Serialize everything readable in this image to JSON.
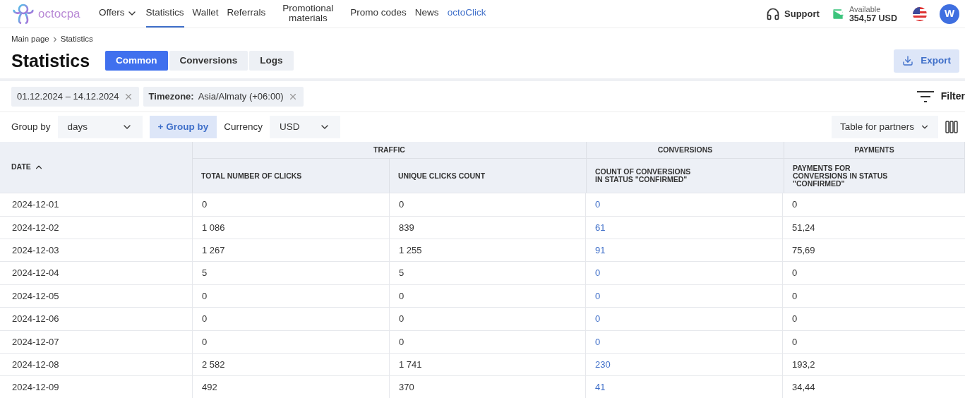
{
  "logo": {
    "text": "octocpa"
  },
  "nav": [
    {
      "label": "Offers",
      "kind": "dropdown",
      "selected": false
    },
    {
      "label": "Statistics",
      "kind": "link",
      "selected": true
    },
    {
      "label": "Wallet",
      "kind": "link",
      "selected": false
    },
    {
      "label": "Referrals",
      "kind": "link",
      "selected": false
    },
    {
      "label": "Promotional materials",
      "kind": "wrap",
      "selected": false
    },
    {
      "label": "Promo codes",
      "kind": "link",
      "selected": false
    },
    {
      "label": "News",
      "kind": "link",
      "selected": false
    },
    {
      "label": "octoClick",
      "kind": "accent",
      "selected": false
    }
  ],
  "support": "Support",
  "balance": {
    "label": "Available",
    "amount": "354,57 USD"
  },
  "avatar": "W",
  "breadcrumbs": [
    "Main page",
    "Statistics"
  ],
  "title": "Statistics",
  "tabs": [
    {
      "label": "Common",
      "selected": true
    },
    {
      "label": "Conversions",
      "selected": false
    },
    {
      "label": "Logs",
      "selected": false
    }
  ],
  "export": "Export",
  "chips": [
    {
      "value": "01.12.2024 – 14.12.2024"
    },
    {
      "label": "Timezone:",
      "value": "Asia/Almaty (+06:00)"
    }
  ],
  "filter": "Filter",
  "group_by": {
    "label": "Group by",
    "value": "days",
    "add": "+ Group by"
  },
  "currency": {
    "label": "Currency",
    "value": "USD"
  },
  "view": "Table for partners",
  "table": {
    "date_column": "DATE",
    "groups": [
      {
        "title": "TRAFFIC",
        "columns": [
          "TOTAL NUMBER OF CLICKS",
          "UNIQUE CLICKS COUNT"
        ]
      },
      {
        "title": "CONVERSIONS",
        "columns": [
          "COUNT OF CONVERSIONS IN STATUS \"CONFIRMED\""
        ]
      },
      {
        "title": "PAYMENTS",
        "columns": [
          "PAYMENTS FOR CONVERSIONS IN STATUS \"CONFIRMED\""
        ]
      }
    ],
    "rows": [
      [
        "2024-12-01",
        "0",
        "0",
        "0",
        "0"
      ],
      [
        "2024-12-02",
        "1 086",
        "839",
        "61",
        "51,24"
      ],
      [
        "2024-12-03",
        "1 267",
        "1 255",
        "91",
        "75,69"
      ],
      [
        "2024-12-04",
        "5",
        "5",
        "0",
        "0"
      ],
      [
        "2024-12-05",
        "0",
        "0",
        "0",
        "0"
      ],
      [
        "2024-12-06",
        "0",
        "0",
        "0",
        "0"
      ],
      [
        "2024-12-07",
        "0",
        "0",
        "0",
        "0"
      ],
      [
        "2024-12-08",
        "2 582",
        "1 741",
        "230",
        "193,2"
      ],
      [
        "2024-12-09",
        "492",
        "370",
        "41",
        "34,44"
      ]
    ]
  }
}
